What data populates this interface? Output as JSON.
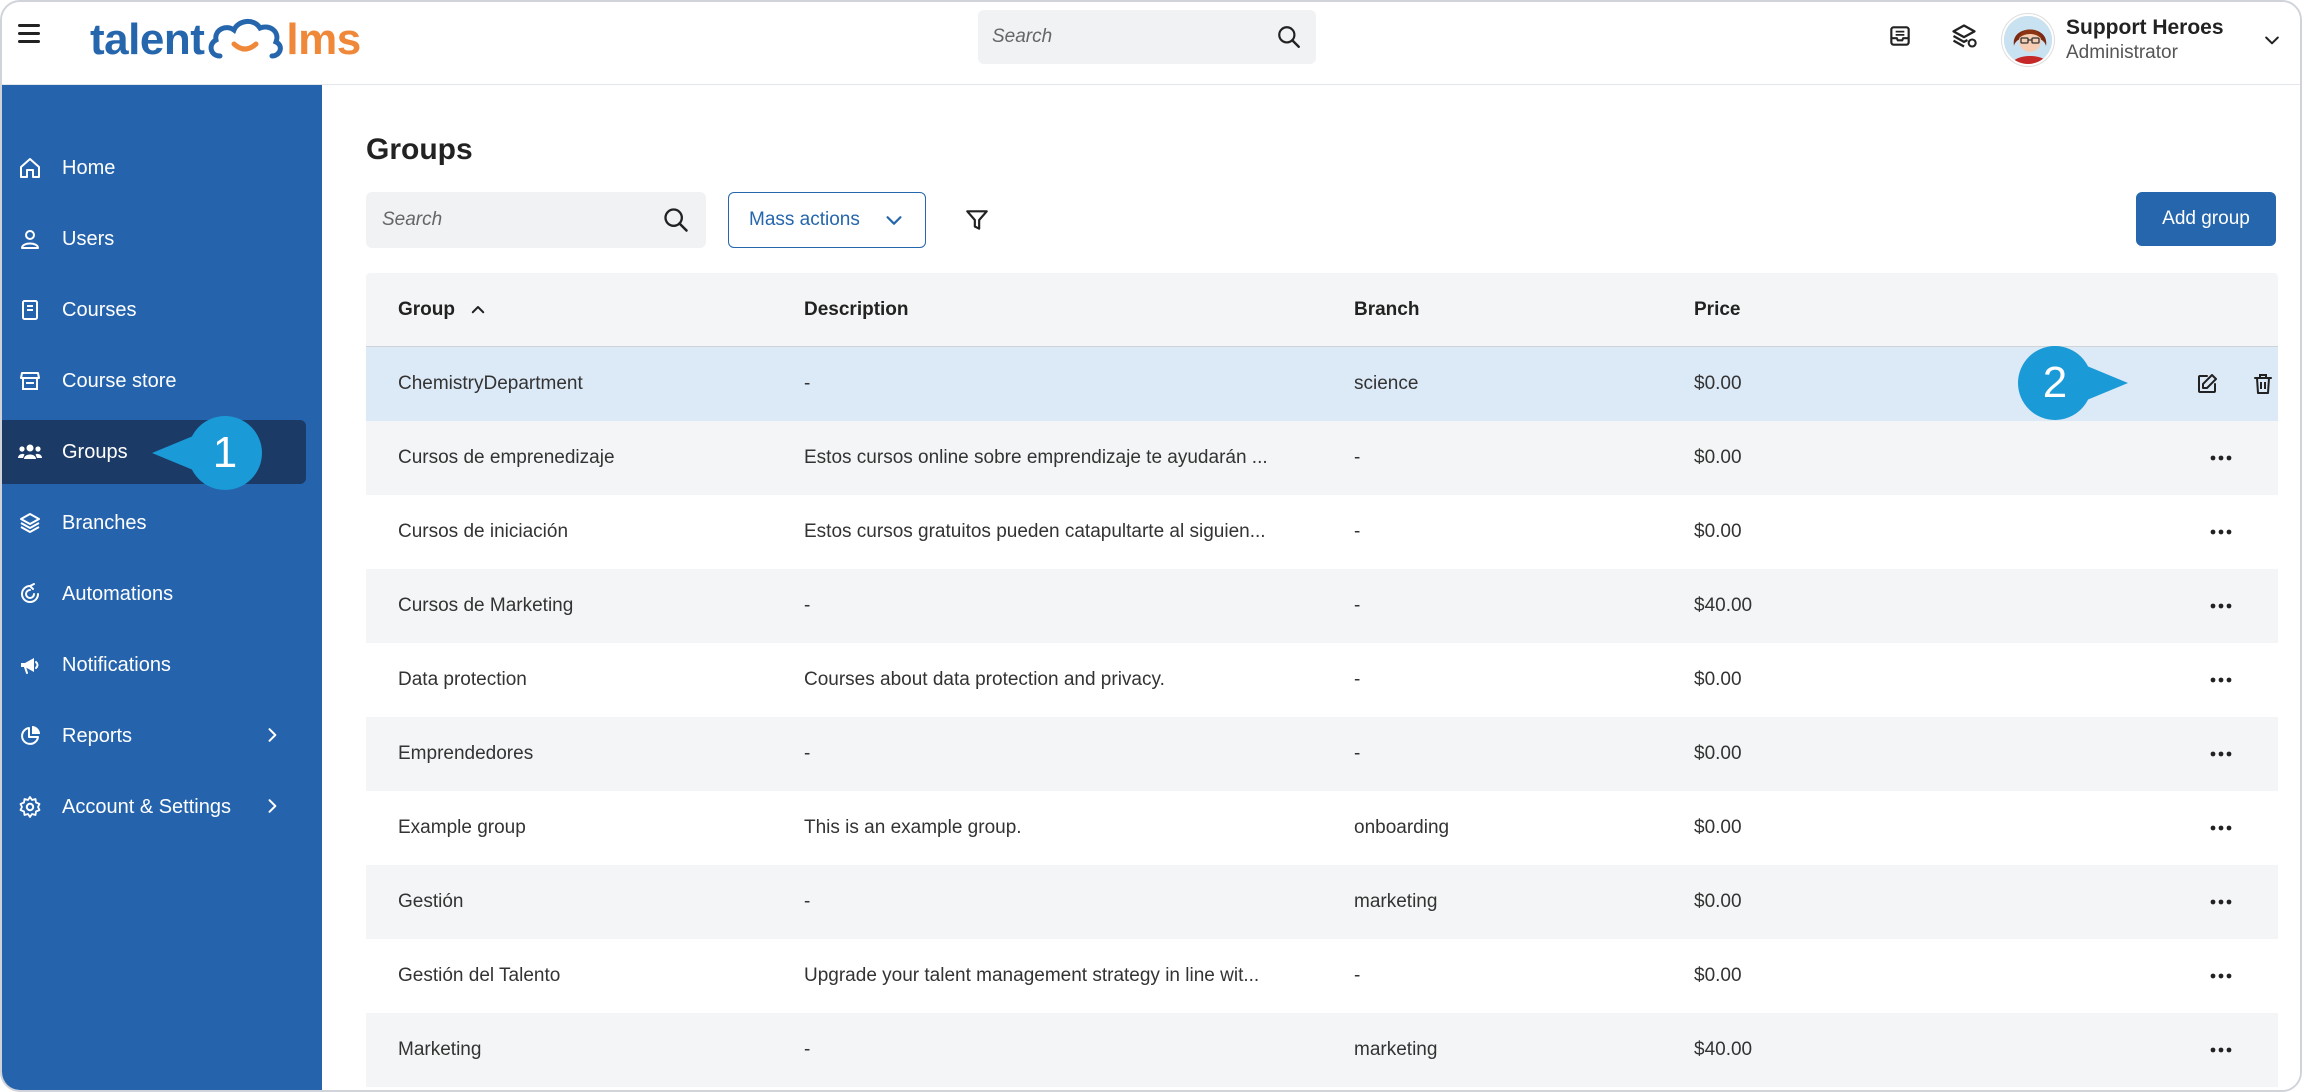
{
  "header": {
    "logo_part1": "talent",
    "logo_part2": "lms",
    "search_placeholder": "Search",
    "user": {
      "name": "Support Heroes",
      "role": "Administrator"
    }
  },
  "sidebar": {
    "items": [
      {
        "label": "Home",
        "icon": "home-icon"
      },
      {
        "label": "Users",
        "icon": "user-icon"
      },
      {
        "label": "Courses",
        "icon": "book-icon"
      },
      {
        "label": "Course store",
        "icon": "store-icon"
      },
      {
        "label": "Groups",
        "icon": "groups-icon",
        "active": true
      },
      {
        "label": "Branches",
        "icon": "layers-icon"
      },
      {
        "label": "Automations",
        "icon": "automation-icon"
      },
      {
        "label": "Notifications",
        "icon": "megaphone-icon"
      },
      {
        "label": "Reports",
        "icon": "pie-chart-icon",
        "has_children": true
      },
      {
        "label": "Account & Settings",
        "icon": "gear-icon",
        "has_children": true
      }
    ]
  },
  "callouts": {
    "one": "1",
    "two": "2"
  },
  "main": {
    "title": "Groups",
    "search_placeholder": "Search",
    "mass_actions_label": "Mass actions",
    "add_group_label": "Add group",
    "table": {
      "headers": {
        "group": "Group",
        "description": "Description",
        "branch": "Branch",
        "price": "Price"
      },
      "rows": [
        {
          "group": "ChemistryDepartment",
          "description": "-",
          "branch": "science",
          "price": "$0.00"
        },
        {
          "group": "Cursos de emprenedizaje",
          "description": "Estos cursos online sobre emprendizaje te ayudarán ...",
          "branch": "-",
          "price": "$0.00"
        },
        {
          "group": "Cursos de iniciación",
          "description": "Estos cursos gratuitos pueden catapultarte al siguien...",
          "branch": "-",
          "price": "$0.00"
        },
        {
          "group": "Cursos de Marketing",
          "description": "-",
          "branch": "-",
          "price": "$40.00"
        },
        {
          "group": "Data protection",
          "description": "Courses about data protection and privacy.",
          "branch": "-",
          "price": "$0.00"
        },
        {
          "group": "Emprendedores",
          "description": "-",
          "branch": "-",
          "price": "$0.00"
        },
        {
          "group": "Example group",
          "description": "This is an example group.",
          "branch": "onboarding",
          "price": "$0.00"
        },
        {
          "group": "Gestión",
          "description": "-",
          "branch": "marketing",
          "price": "$0.00"
        },
        {
          "group": "Gestión del Talento",
          "description": "Upgrade your talent management strategy in line wit...",
          "branch": "-",
          "price": "$0.00"
        },
        {
          "group": "Marketing",
          "description": "-",
          "branch": "marketing",
          "price": "$40.00"
        }
      ]
    }
  },
  "colors": {
    "brand_blue": "#2566ad",
    "brand_orange": "#f0883a",
    "sidebar_bg": "#2564ad",
    "sidebar_active": "#1b3a66",
    "callout": "#1a9ad6",
    "row_highlight": "#dce9f7"
  }
}
